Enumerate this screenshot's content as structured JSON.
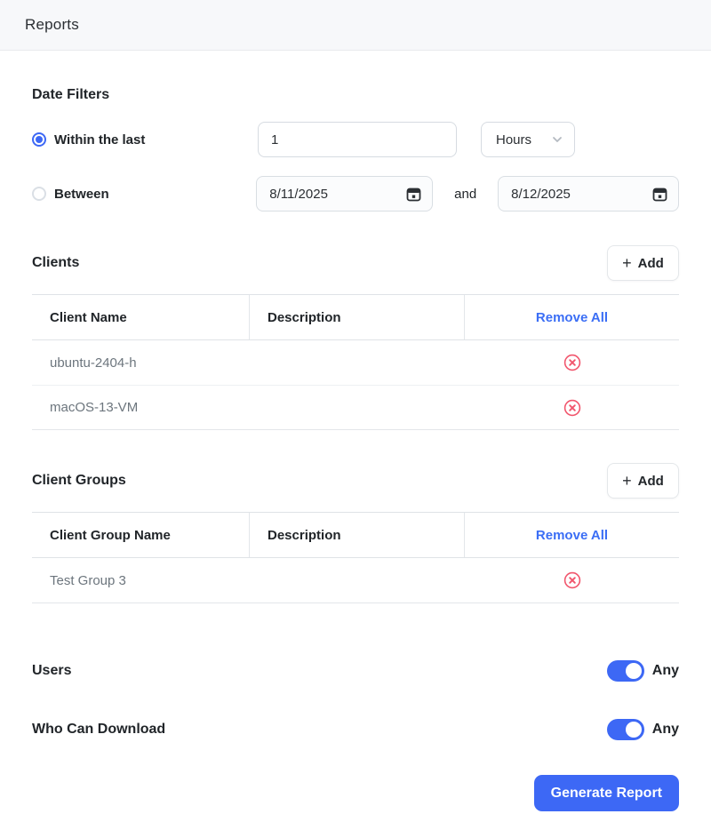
{
  "header": {
    "title": "Reports"
  },
  "date_filters": {
    "title": "Date Filters",
    "within_last_label": "Within the last",
    "within_last_value": "1",
    "unit_selected": "Hours",
    "between_label": "Between",
    "start_date": "8/11/2025",
    "and_label": "and",
    "end_date": "8/12/2025"
  },
  "clients": {
    "title": "Clients",
    "add_label": "Add",
    "columns": [
      "Client Name",
      "Description",
      "Remove All"
    ],
    "rows": [
      {
        "name": "ubuntu-2404-h",
        "description": ""
      },
      {
        "name": "macOS-13-VM",
        "description": ""
      }
    ]
  },
  "client_groups": {
    "title": "Client Groups",
    "add_label": "Add",
    "columns": [
      "Client Group Name",
      "Description",
      "Remove All"
    ],
    "rows": [
      {
        "name": "Test Group 3",
        "description": ""
      }
    ]
  },
  "toggles": {
    "users": {
      "label": "Users",
      "state": "Any",
      "on": true
    },
    "who_can_download": {
      "label": "Who Can Download",
      "state": "Any",
      "on": true
    }
  },
  "footer": {
    "generate_label": "Generate Report"
  },
  "colors": {
    "accent_blue": "#3d68f5",
    "danger_red": "#f1556c",
    "header_bg": "#f7f8fa",
    "muted_text": "#6c757d"
  }
}
